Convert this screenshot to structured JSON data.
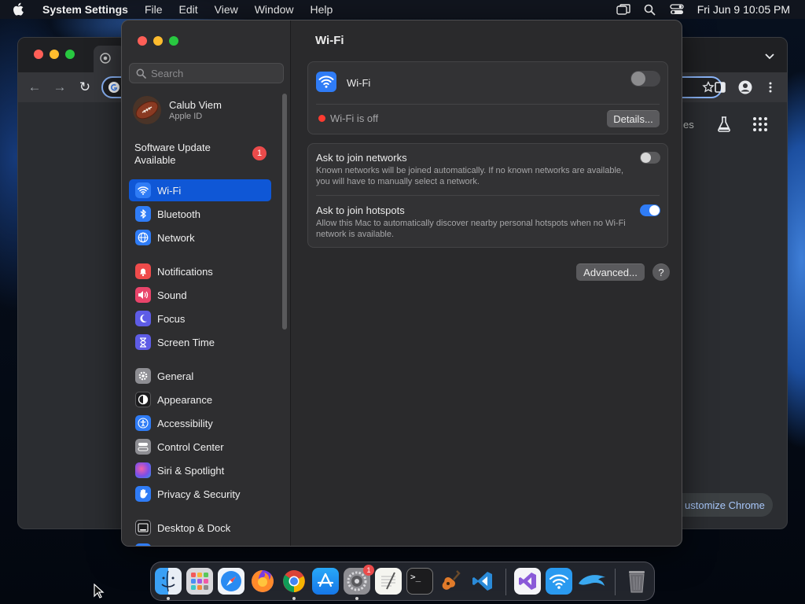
{
  "menubar": {
    "app_name": "System Settings",
    "menus": [
      "File",
      "Edit",
      "View",
      "Window",
      "Help"
    ],
    "clock": "Fri Jun 9  10:05 PM"
  },
  "chrome": {
    "ntp_link_text": "es",
    "customize_label": "ustomize Chrome"
  },
  "sidebar": {
    "search_placeholder": "Search",
    "account": {
      "name": "Calub Viem",
      "subtitle": "Apple ID"
    },
    "update": {
      "label_line1": "Software Update",
      "label_line2": "Available",
      "badge": "1"
    },
    "items": [
      {
        "label": "Wi-Fi",
        "icon": "wifi-icon",
        "color": "#2f7cf6"
      },
      {
        "label": "Bluetooth",
        "icon": "bluetooth-icon",
        "color": "#2f7cf6"
      },
      {
        "label": "Network",
        "icon": "globe-icon",
        "color": "#2f7cf6"
      },
      {
        "label": "Notifications",
        "icon": "bell-icon",
        "color": "#ef4b4b"
      },
      {
        "label": "Sound",
        "icon": "speaker-icon",
        "color": "#e9446a"
      },
      {
        "label": "Focus",
        "icon": "moon-icon",
        "color": "#5e5ce6"
      },
      {
        "label": "Screen Time",
        "icon": "hourglass-icon",
        "color": "#5e5ce6"
      },
      {
        "label": "General",
        "icon": "gear-icon",
        "color": "#8e8e93"
      },
      {
        "label": "Appearance",
        "icon": "appearance-icon",
        "color": "#1c1c1e"
      },
      {
        "label": "Accessibility",
        "icon": "accessibility-icon",
        "color": "#2f7cf6"
      },
      {
        "label": "Control Center",
        "icon": "control-center-icon",
        "color": "#8e8e93"
      },
      {
        "label": "Siri & Spotlight",
        "icon": "siri-icon",
        "color": "#b04fd6"
      },
      {
        "label": "Privacy & Security",
        "icon": "hand-icon",
        "color": "#2f7cf6"
      },
      {
        "label": "Desktop & Dock",
        "icon": "desktop-dock-icon",
        "color": "#1c1c1e"
      }
    ]
  },
  "main": {
    "title": "Wi-Fi",
    "wifi_card": {
      "label": "Wi-Fi",
      "status_text": "Wi-Fi is off",
      "status_color": "#ff3b30",
      "details_button": "Details..."
    },
    "options": [
      {
        "title": "Ask to join networks",
        "description": "Known networks will be joined automatically. If no known networks are available, you will have to manually select a network.",
        "enabled": false
      },
      {
        "title": "Ask to join hotspots",
        "description": "Allow this Mac to automatically discover nearby personal hotspots when no Wi-Fi network is available.",
        "enabled": true
      }
    ],
    "advanced_button": "Advanced...",
    "help_button": "?"
  },
  "dock": {
    "apps": [
      "Finder",
      "Launchpad",
      "Safari",
      "Firefox",
      "Chrome",
      "App Store",
      "System Settings",
      "TextEdit",
      "Terminal",
      "GarageBand",
      "Visual Studio Code",
      "Visual Studio",
      "Wireless Diagnostics",
      "Dolphin",
      "Trash"
    ],
    "settings_badge": "1"
  },
  "colors": {
    "accent": "#0f57d6",
    "toggle_on": "#2f7cf6"
  }
}
